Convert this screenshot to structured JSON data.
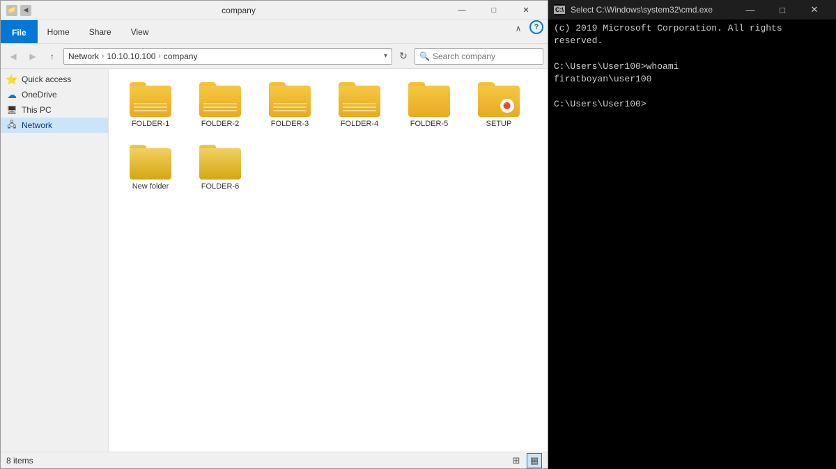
{
  "explorer": {
    "title": "company",
    "title_bar": {
      "icon": "📁",
      "buttons": [
        "—",
        "□",
        "✕"
      ]
    },
    "ribbon": {
      "tabs": [
        "File",
        "Home",
        "Share",
        "View"
      ]
    },
    "address_bar": {
      "path_parts": [
        "Network",
        "10.10.10.100",
        "company"
      ],
      "search_placeholder": "Search company",
      "search_label": "Search"
    },
    "sidebar": {
      "items": [
        {
          "label": "Quick access",
          "icon": "⭐",
          "type": "section"
        },
        {
          "label": "OneDrive",
          "icon": "☁",
          "type": "item"
        },
        {
          "label": "This PC",
          "icon": "💻",
          "type": "item"
        },
        {
          "label": "Network",
          "icon": "🖧",
          "type": "item",
          "active": true
        }
      ]
    },
    "folders": [
      {
        "name": "FOLDER-1",
        "has_lines": true,
        "is_setup": false
      },
      {
        "name": "FOLDER-2",
        "has_lines": true,
        "is_setup": false
      },
      {
        "name": "FOLDER-3",
        "has_lines": true,
        "is_setup": false
      },
      {
        "name": "FOLDER-4",
        "has_lines": true,
        "is_setup": false
      },
      {
        "name": "FOLDER-5",
        "has_lines": false,
        "is_setup": false
      },
      {
        "name": "SETUP",
        "has_lines": false,
        "is_setup": true
      },
      {
        "name": "New folder",
        "has_lines": false,
        "is_setup": false,
        "lighter": true
      },
      {
        "name": "FOLDER-6",
        "has_lines": false,
        "is_setup": false,
        "lighter": true
      }
    ],
    "status_bar": {
      "item_count": "8 items"
    }
  },
  "cmd": {
    "title": "Select C:\\Windows\\system32\\cmd.exe",
    "copyright": "(c) 2019 Microsoft Corporation. All rights reserved.",
    "lines": [
      "C:\\Users\\User100>whoami",
      "firatboyan\\user100",
      "",
      "C:\\Users\\User100>"
    ]
  }
}
